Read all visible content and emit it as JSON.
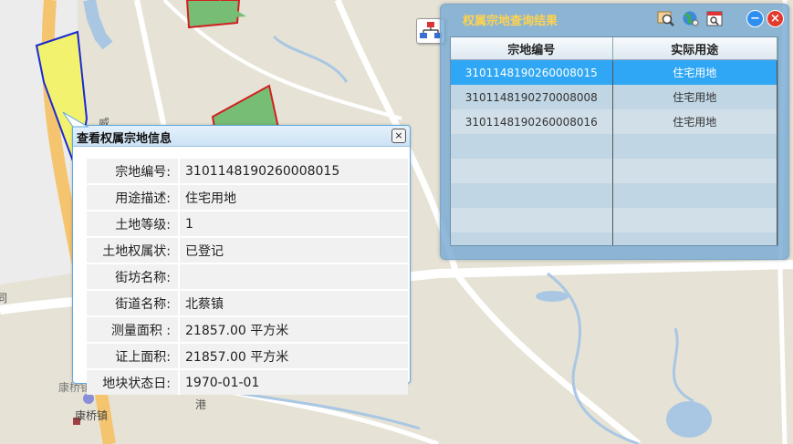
{
  "map": {
    "labels": [
      {
        "id": "wei",
        "text": "威"
      },
      {
        "id": "gang",
        "text": "港"
      },
      {
        "id": "kangqiao",
        "text": "康桥镇"
      },
      {
        "id": "community",
        "text": "康桥镇社区事务受理服务中心"
      },
      {
        "id": "edge-left",
        "text": "同"
      }
    ],
    "colors": {
      "background": "#e6e3d6",
      "road": "#ffffff",
      "water": "#a9c7e3",
      "highway": "#f5c46e",
      "parcel_green": "#77bd75",
      "parcel_yellow": "#f2f26f"
    }
  },
  "results_panel": {
    "title": "权属宗地查询结果",
    "icons": [
      "zoom-to-icon",
      "globe-icon",
      "calendar-search-icon"
    ],
    "minimize_icon": "minimize-icon",
    "close_icon": "close-icon",
    "columns": [
      "宗地编号",
      "实际用途"
    ],
    "rows": [
      {
        "id": "3101148190260008015",
        "use": "住宅用地",
        "selected": true
      },
      {
        "id": "3101148190270008008",
        "use": "住宅用地",
        "selected": false
      },
      {
        "id": "3101148190260008016",
        "use": "住宅用地",
        "selected": false
      }
    ]
  },
  "info_popup": {
    "title": "查看权属宗地信息",
    "close_label": "×",
    "fields": [
      {
        "label": "宗地编号:",
        "value": "3101148190260008015"
      },
      {
        "label": "用途描述:",
        "value": "住宅用地"
      },
      {
        "label": "土地等级:",
        "value": "1"
      },
      {
        "label": "土地权属状:",
        "value": "已登记"
      },
      {
        "label": "街坊名称:",
        "value": ""
      },
      {
        "label": "街道名称:",
        "value": "北蔡镇"
      },
      {
        "label": "测量面积 :",
        "value": "21857.00 平方米"
      },
      {
        "label": "证上面积:",
        "value": "21857.00 平方米"
      },
      {
        "label": "地块状态日:",
        "value": "1970-01-01"
      }
    ]
  }
}
